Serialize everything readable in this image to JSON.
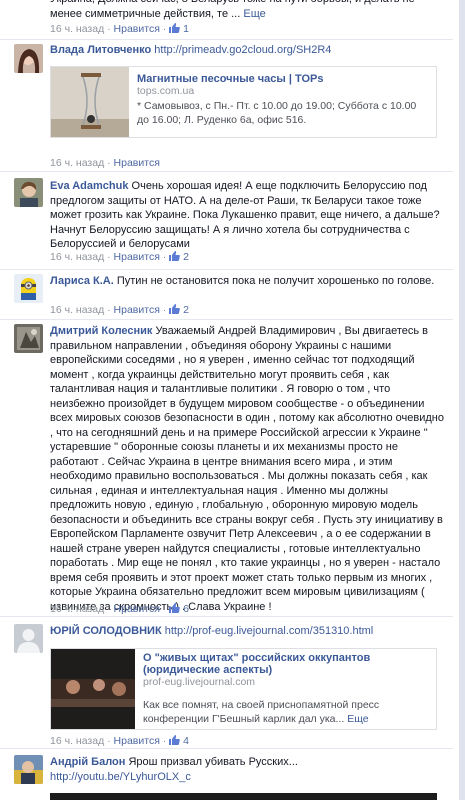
{
  "comments": [
    {
      "author": "",
      "text": "Украина, Должна сейчас, 8 Беларусь тоже на пути борьбы, и делать не менее симметричные действия, те ...",
      "more_label": "Еще",
      "time": "16 ч. назад",
      "like_label": "Нравится",
      "likes": "1"
    },
    {
      "author": "Влада Литовченко",
      "link": "http://primeadv.go2cloud.org/SH2R4",
      "preview": {
        "title": "Магнитные песочные часы | TOPs",
        "domain": "tops.com.ua",
        "description": "* Самовывоз, с Пн.- Пт. с 10.00 до 19.00; Суббота с 10.00 до 16.00; Л. Руденко 6а, офис 516."
      },
      "time": "16 ч. назад",
      "like_label": "Нравится"
    },
    {
      "author": "Eva Adamchuk",
      "text": "Очень хорошая идея! А еще подключить Белоруссию под предлогом защиты от НАТО. А на деле-от Раши, тк Беларуси такое тоже может грозить как Украине. Пока Лукашенко правит, еще ничего, а дальше? Начнут Белоруссию защищать! А я лично хотела бы сотрудничества с Белоруссией и белорусами",
      "time": "16 ч. назад",
      "like_label": "Нравится",
      "likes": "2"
    },
    {
      "author": "Лариса К.А.",
      "text": "Путин не остановится пока не получит хорошенько по голове.",
      "time": "16 ч. назад",
      "like_label": "Нравится",
      "likes": "2"
    },
    {
      "author": "Дмитрий Колесник",
      "text": "Уважаемый Андрей Владимирович , Вы двигаетесь в правильном направлении , объединяя оборону Украины с нашими европейскими соседями , но я уверен , именно сейчас тот подходящий момент , когда украинцы действительно могут проявить себя , как талантливая нация и талантливые политики . Я говорю о том , что неизбежно произойдет в будущем мировом сообществе - о объединении всех мировых союзов безопасности в один , потому как абсолютно очевидно , что на сегодняшний день и на примере Российской агрессии к Украине \" устаревшие \" оборонные союзы планеты и их механизмы просто не работают . Сейчас Украина в центре внимания всего мира , и этим необходимо правильно воспользоваться . Мы должны показать себя , как сильная , единая и интеллектуальная нация . Именно мы должны предложить новую , единую , глобальную , оборонную мировую модель безопасности и объединить все страны вокруг себя . Пусть эту инициативу в Европейском Парламенте озвучит Петр Алексеевич , а о ее содержании в нашей стране уверен найдутся специалисты , готовые интеллектуально поработать . Мир еще не понял , кто такие украинцы , но я уверен - настало время себя проявить и этот проект может стать только первым из многих , которые Украина обязательно предложит всем мировым цивилизациям ( извините за скромность ) . Слава Украине !",
      "time": "16 ч. назад",
      "like_label": "Нравится",
      "likes": "6"
    },
    {
      "author": "ЮРІЙ СОЛОДОВНИК",
      "link": "http://prof-eug.livejournal.com/351310.html",
      "preview": {
        "title": "О \"живых щитах\" российских оккупантов (юридические аспекты)",
        "domain": "prof-eug.livejournal.com",
        "description": "Как все помнят, на своей приснопамятной пресс конференции Г'Бешный карлик дал ука..."
      },
      "more_label": "Еще",
      "time": "16 ч. назад",
      "like_label": "Нравится",
      "likes": "4"
    },
    {
      "author": "Андрій Балон",
      "text": "Ярош призвал убивать Русских...",
      "link": "http://youtu.be/YLyhurOLX_c"
    }
  ],
  "colors": {
    "link": "#3b5998",
    "meta": "#90949c",
    "border": "#dddfe2"
  }
}
